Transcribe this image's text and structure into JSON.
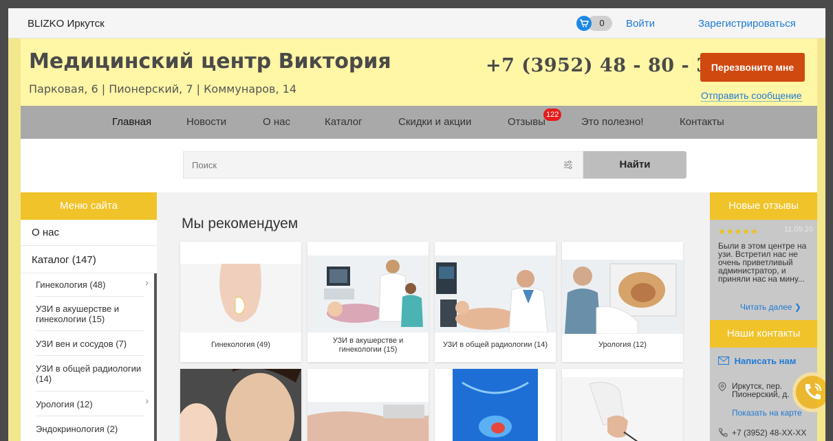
{
  "topbar": {
    "city": "BLIZKO Иркутск",
    "cart_count": "0",
    "login": "Войти",
    "register": "Зарегистрироваться"
  },
  "header": {
    "title": "Медицинский центр Виктория",
    "address": "Парковая, 6 | Пионерский, 7 | Коммунаров, 14",
    "phone": "+7 (3952) 48 - 80 - 38",
    "callback_label": "Перезвоните мне",
    "send_message": "Отправить сообщение"
  },
  "nav": {
    "items": [
      "Главная",
      "Новости",
      "О нас",
      "Каталог",
      "Скидки и акции",
      "Отзывы",
      "Это полезно!",
      "Контакты"
    ],
    "reviews_badge": "122"
  },
  "search": {
    "placeholder": "Поиск",
    "button": "Найти"
  },
  "sidebar": {
    "header": "Меню сайта",
    "items": [
      "О нас",
      "Каталог (147)"
    ],
    "subitems": [
      "Гинекология (48)",
      "УЗИ в акушерстве и гинекологии (15)",
      "УЗИ вен и сосудов (7)",
      "УЗИ в общей радиологии (14)",
      "Урология (12)",
      "Эндокринология (2)"
    ]
  },
  "main": {
    "title": "Мы рекомендуем",
    "cards": [
      "Гинекология (49)",
      "УЗИ в акушерстве и гинекологии (15)",
      "УЗИ в общей радиологии (14)",
      "Урология (12)"
    ]
  },
  "right": {
    "reviews_header": "Новые отзывы",
    "stars": "★★★★★",
    "review_date": "11.09.20",
    "review_text": "Были в этом центре на узи. Встретил нас не очень приветливый администратор, и приняли нас на мину...",
    "read_more": "Читать далее ❯",
    "contacts_header": "Наши контакты",
    "write_us": "Написать нам",
    "address": "Иркутск, пер. Пионерский, д. 7",
    "map_link": "Показать на карте",
    "phone": "+7 (3952) 48-XX-XX"
  },
  "colors": {
    "accent": "#f0c32a",
    "header_bg": "#fff6a6",
    "callback": "#d04a10",
    "link": "#1e7ad6"
  }
}
